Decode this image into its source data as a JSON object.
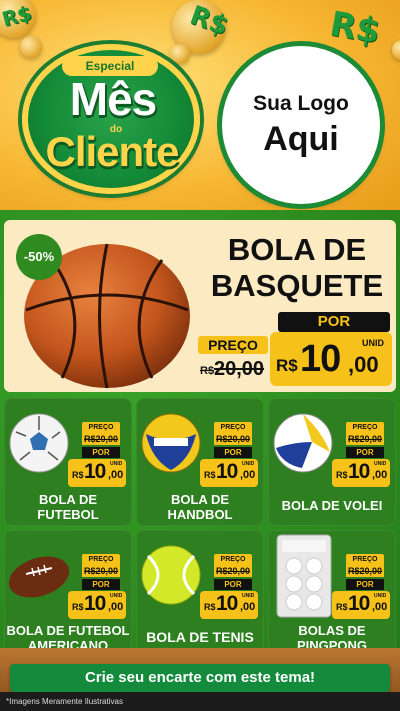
{
  "header": {
    "badge_especial": "Especial",
    "badge_line1": "Mês",
    "badge_line2": "do",
    "badge_line3": "Cliente",
    "logo_line1": "Sua Logo",
    "logo_line2": "Aqui"
  },
  "featured": {
    "discount": "-50%",
    "title_line1": "BOLA DE",
    "title_line2": "BASQUETE",
    "por_label": "POR",
    "preco_label": "PREÇO",
    "old_currency": "R$",
    "old_price": "20,00",
    "unid_label": "UNID",
    "currency": "R$",
    "price_int": "10",
    "price_dec": ",00"
  },
  "products": [
    {
      "name_line1": "BOLA DE",
      "name_line2": "FUTEBOL",
      "preco_label": "PREÇO",
      "old_price": "R$20,00",
      "por_label": "POR",
      "currency": "R$",
      "price_int": "10",
      "price_dec": ",00",
      "unid_label": "UNID",
      "icon": "soccer-ball-icon"
    },
    {
      "name_line1": "BOLA DE",
      "name_line2": "HANDBOL",
      "preco_label": "PREÇO",
      "old_price": "R$20,00",
      "por_label": "POR",
      "currency": "R$",
      "price_int": "10",
      "price_dec": ",00",
      "unid_label": "UNID",
      "icon": "handball-icon"
    },
    {
      "name_line1": "BOLA DE VOLEI",
      "name_line2": "",
      "preco_label": "PREÇO",
      "old_price": "R$20,00",
      "por_label": "POR",
      "currency": "R$",
      "price_int": "10",
      "price_dec": ",00",
      "unid_label": "UNID",
      "icon": "volleyball-icon"
    },
    {
      "name_line1": "BOLA DE FUTEBOL",
      "name_line2": "AMERICANO",
      "preco_label": "PREÇO",
      "old_price": "R$20,00",
      "por_label": "POR",
      "currency": "R$",
      "price_int": "10",
      "price_dec": ",00",
      "unid_label": "UNID",
      "icon": "american-football-icon"
    },
    {
      "name_line1": "BOLA DE TENIS",
      "name_line2": "",
      "preco_label": "PREÇO",
      "old_price": "R$20,00",
      "por_label": "POR",
      "currency": "R$",
      "price_int": "10",
      "price_dec": ",00",
      "unid_label": "UNID",
      "icon": "tennis-ball-icon"
    },
    {
      "name_line1": "BOLAS DE",
      "name_line2": "PINGPONG",
      "preco_label": "PREÇO",
      "old_price": "R$20,00",
      "por_label": "POR",
      "currency": "R$",
      "price_int": "10",
      "price_dec": ",00",
      "unid_label": "UNID",
      "icon": "pingpong-balls-icon"
    }
  ],
  "footer": {
    "cta": "Crie seu encarte com este tema!",
    "footnote": "*Imagens Meramente Ilustrativas"
  },
  "colors": {
    "green": "#2f8a1f",
    "yellow": "#f6c21a",
    "cream": "#fbeac2",
    "orange_header": "#f7b733"
  }
}
